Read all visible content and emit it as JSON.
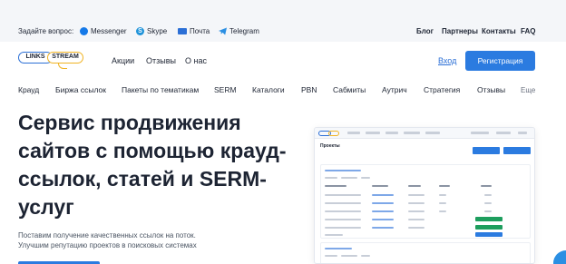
{
  "topbar": {
    "ask_label": "Задайте вопрос:",
    "contacts": [
      {
        "icon": "messenger-icon",
        "label": "Messenger"
      },
      {
        "icon": "skype-icon",
        "label": "Skype"
      },
      {
        "icon": "mail-icon",
        "label": "Почта"
      },
      {
        "icon": "telegram-icon",
        "label": "Telegram"
      }
    ],
    "links": [
      "Блог",
      "Партнеры",
      "Контакты",
      "FAQ"
    ]
  },
  "header": {
    "logo_left": "LINKS",
    "logo_right": "STREAM",
    "nav": [
      "Акции",
      "Отзывы",
      "О нас"
    ],
    "login": "Вход",
    "register": "Регистрация"
  },
  "menu": {
    "items": [
      "Крауд",
      "Биржа ссылок",
      "Пакеты по тематикам",
      "SERM",
      "Каталоги",
      "PBN",
      "Сабмиты",
      "Аутрич",
      "Стратегия",
      "Отзывы"
    ],
    "more": "Еще"
  },
  "hero": {
    "title": "Сервис продвижения сайтов с помощью крауд-ссылок, статей и SERM-услуг",
    "subtitle_1": "Поставим получение качественных ссылок на поток.",
    "subtitle_2": "Улучшим репутацию проектов в поисковых системах"
  },
  "mockup": {
    "heading": "Проекты"
  },
  "colors": {
    "accent": "#2b7be0",
    "logo_yellow": "#f0b323",
    "topbar_bg": "#f4f6f9"
  }
}
